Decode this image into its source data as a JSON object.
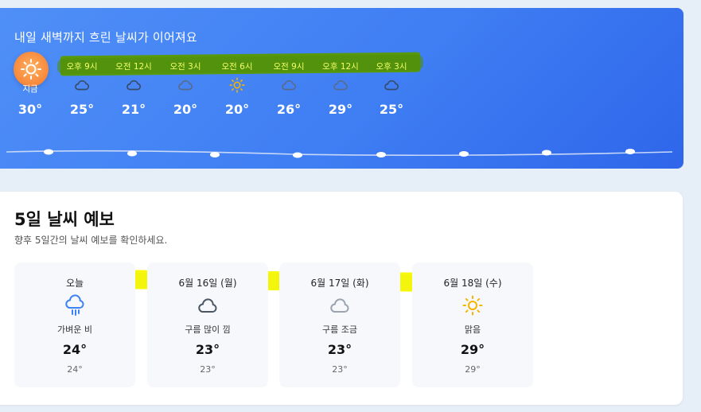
{
  "hourly": {
    "title": "내일 새벽까지 흐린 날씨가 이어져요",
    "items": [
      {
        "label": "지금",
        "icon": "sun-icon",
        "temp": "30°"
      },
      {
        "label": "오후 9시",
        "icon": "cloud-icon",
        "temp": "25°"
      },
      {
        "label": "오전 12시",
        "icon": "cloud-icon",
        "temp": "21°"
      },
      {
        "label": "오전 3시",
        "icon": "cloud-icon",
        "temp": "20°"
      },
      {
        "label": "오전 6시",
        "icon": "sun-icon",
        "temp": "20°"
      },
      {
        "label": "오전 9시",
        "icon": "cloud-icon",
        "temp": "26°"
      },
      {
        "label": "오후 12시",
        "icon": "cloud-icon",
        "temp": "29°"
      },
      {
        "label": "오후 3시",
        "icon": "cloud-icon",
        "temp": "25°"
      }
    ]
  },
  "forecast": {
    "title": "5일 날씨 예보",
    "subtitle": "향후 5일간의 날씨 예보를 확인하세요.",
    "days": [
      {
        "date": "오늘",
        "icon": "rain-icon",
        "desc": "가벼운 비",
        "high": "24°",
        "low": "24°"
      },
      {
        "date": "6월 16일 (월)",
        "icon": "cloud-icon",
        "desc": "구름 많이 낌",
        "high": "23°",
        "low": "23°"
      },
      {
        "date": "6월 17일 (화)",
        "icon": "cloud-icon",
        "desc": "구름 조금",
        "high": "23°",
        "low": "23°"
      },
      {
        "date": "6월 18일 (수)",
        "icon": "sun-icon",
        "desc": "맑음",
        "high": "29°",
        "low": "29°"
      }
    ]
  },
  "colors": {
    "panel_blue": "#3f7ef3",
    "sun_orange": "#f7873a",
    "sun_yellow": "#f5b400",
    "highlight_green": "#5a9a00",
    "highlight_yellow": "#f8f800"
  }
}
